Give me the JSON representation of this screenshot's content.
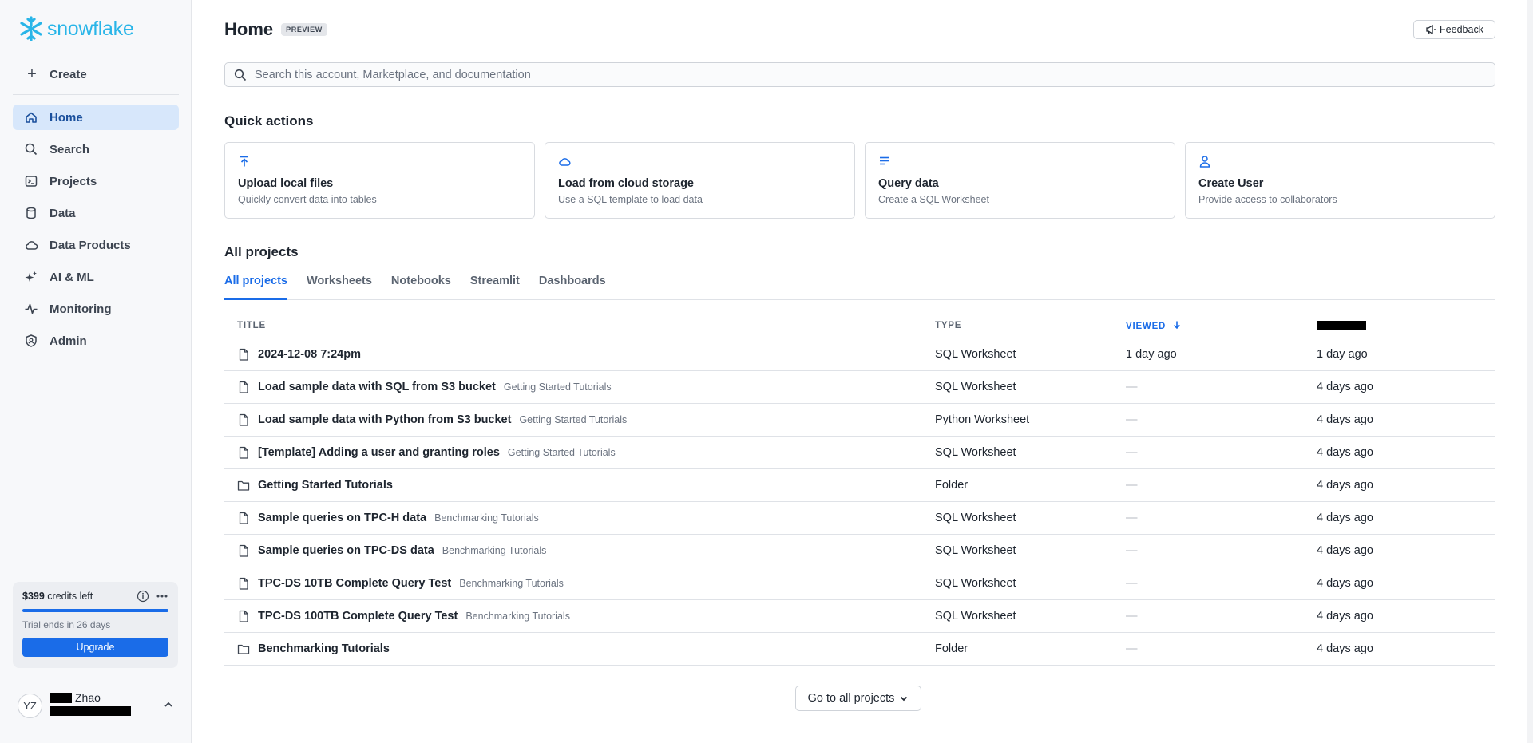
{
  "sidebar": {
    "logo_text": "snowflake",
    "create_label": "Create",
    "items": [
      {
        "label": "Home",
        "icon": "home-icon",
        "active": true
      },
      {
        "label": "Search",
        "icon": "search-icon"
      },
      {
        "label": "Projects",
        "icon": "terminal-icon"
      },
      {
        "label": "Data",
        "icon": "database-icon"
      },
      {
        "label": "Data Products",
        "icon": "cloud-icon"
      },
      {
        "label": "AI & ML",
        "icon": "sparkle-icon"
      },
      {
        "label": "Monitoring",
        "icon": "activity-icon"
      },
      {
        "label": "Admin",
        "icon": "shield-icon"
      }
    ],
    "credits": {
      "amount": "$399",
      "suffix": " credits left",
      "trial_text": "Trial ends in 26 days",
      "upgrade_label": "Upgrade"
    },
    "user": {
      "initials": "YZ",
      "name": "Zhao"
    }
  },
  "header": {
    "title": "Home",
    "badge": "PREVIEW",
    "feedback_label": "Feedback"
  },
  "search": {
    "placeholder": "Search this account, Marketplace, and documentation"
  },
  "quick_actions": {
    "title": "Quick actions",
    "cards": [
      {
        "title": "Upload local files",
        "subtitle": "Quickly convert data into tables",
        "icon": "upload-icon"
      },
      {
        "title": "Load from cloud storage",
        "subtitle": "Use a SQL template to load data",
        "icon": "cloud-icon"
      },
      {
        "title": "Query data",
        "subtitle": "Create a SQL Worksheet",
        "icon": "lines-icon"
      },
      {
        "title": "Create User",
        "subtitle": "Provide access to collaborators",
        "icon": "user-icon"
      }
    ]
  },
  "projects": {
    "title": "All projects",
    "tabs": [
      "All projects",
      "Worksheets",
      "Notebooks",
      "Streamlit",
      "Dashboards"
    ],
    "columns": {
      "title": "TITLE",
      "type": "TYPE",
      "viewed": "VIEWED"
    },
    "rows": [
      {
        "icon": "file-icon",
        "name": "2024-12-08 7:24pm",
        "folder": "",
        "type": "SQL Worksheet",
        "viewed": "1 day ago",
        "updated": "1 day ago"
      },
      {
        "icon": "file-icon",
        "name": "Load sample data with SQL from S3 bucket",
        "folder": "Getting Started Tutorials",
        "type": "SQL Worksheet",
        "viewed": "—",
        "updated": "4 days ago"
      },
      {
        "icon": "file-icon",
        "name": "Load sample data with Python from S3 bucket",
        "folder": "Getting Started Tutorials",
        "type": "Python Worksheet",
        "viewed": "—",
        "updated": "4 days ago"
      },
      {
        "icon": "file-icon",
        "name": "[Template] Adding a user and granting roles",
        "folder": "Getting Started Tutorials",
        "type": "SQL Worksheet",
        "viewed": "—",
        "updated": "4 days ago"
      },
      {
        "icon": "folder-icon",
        "name": "Getting Started Tutorials",
        "folder": "",
        "type": "Folder",
        "viewed": "—",
        "updated": "4 days ago"
      },
      {
        "icon": "file-icon",
        "name": "Sample queries on TPC-H data",
        "folder": "Benchmarking Tutorials",
        "type": "SQL Worksheet",
        "viewed": "—",
        "updated": "4 days ago"
      },
      {
        "icon": "file-icon",
        "name": "Sample queries on TPC-DS data",
        "folder": "Benchmarking Tutorials",
        "type": "SQL Worksheet",
        "viewed": "—",
        "updated": "4 days ago"
      },
      {
        "icon": "file-icon",
        "name": "TPC-DS 10TB Complete Query Test",
        "folder": "Benchmarking Tutorials",
        "type": "SQL Worksheet",
        "viewed": "—",
        "updated": "4 days ago"
      },
      {
        "icon": "file-icon",
        "name": "TPC-DS 100TB Complete Query Test",
        "folder": "Benchmarking Tutorials",
        "type": "SQL Worksheet",
        "viewed": "—",
        "updated": "4 days ago"
      },
      {
        "icon": "folder-icon",
        "name": "Benchmarking Tutorials",
        "folder": "",
        "type": "Folder",
        "viewed": "—",
        "updated": "4 days ago"
      }
    ],
    "goto_label": "Go to all projects"
  },
  "colors": {
    "accent": "#1a6ce8",
    "logo": "#29b5e8",
    "nav_active_bg": "#d7e7fb"
  }
}
